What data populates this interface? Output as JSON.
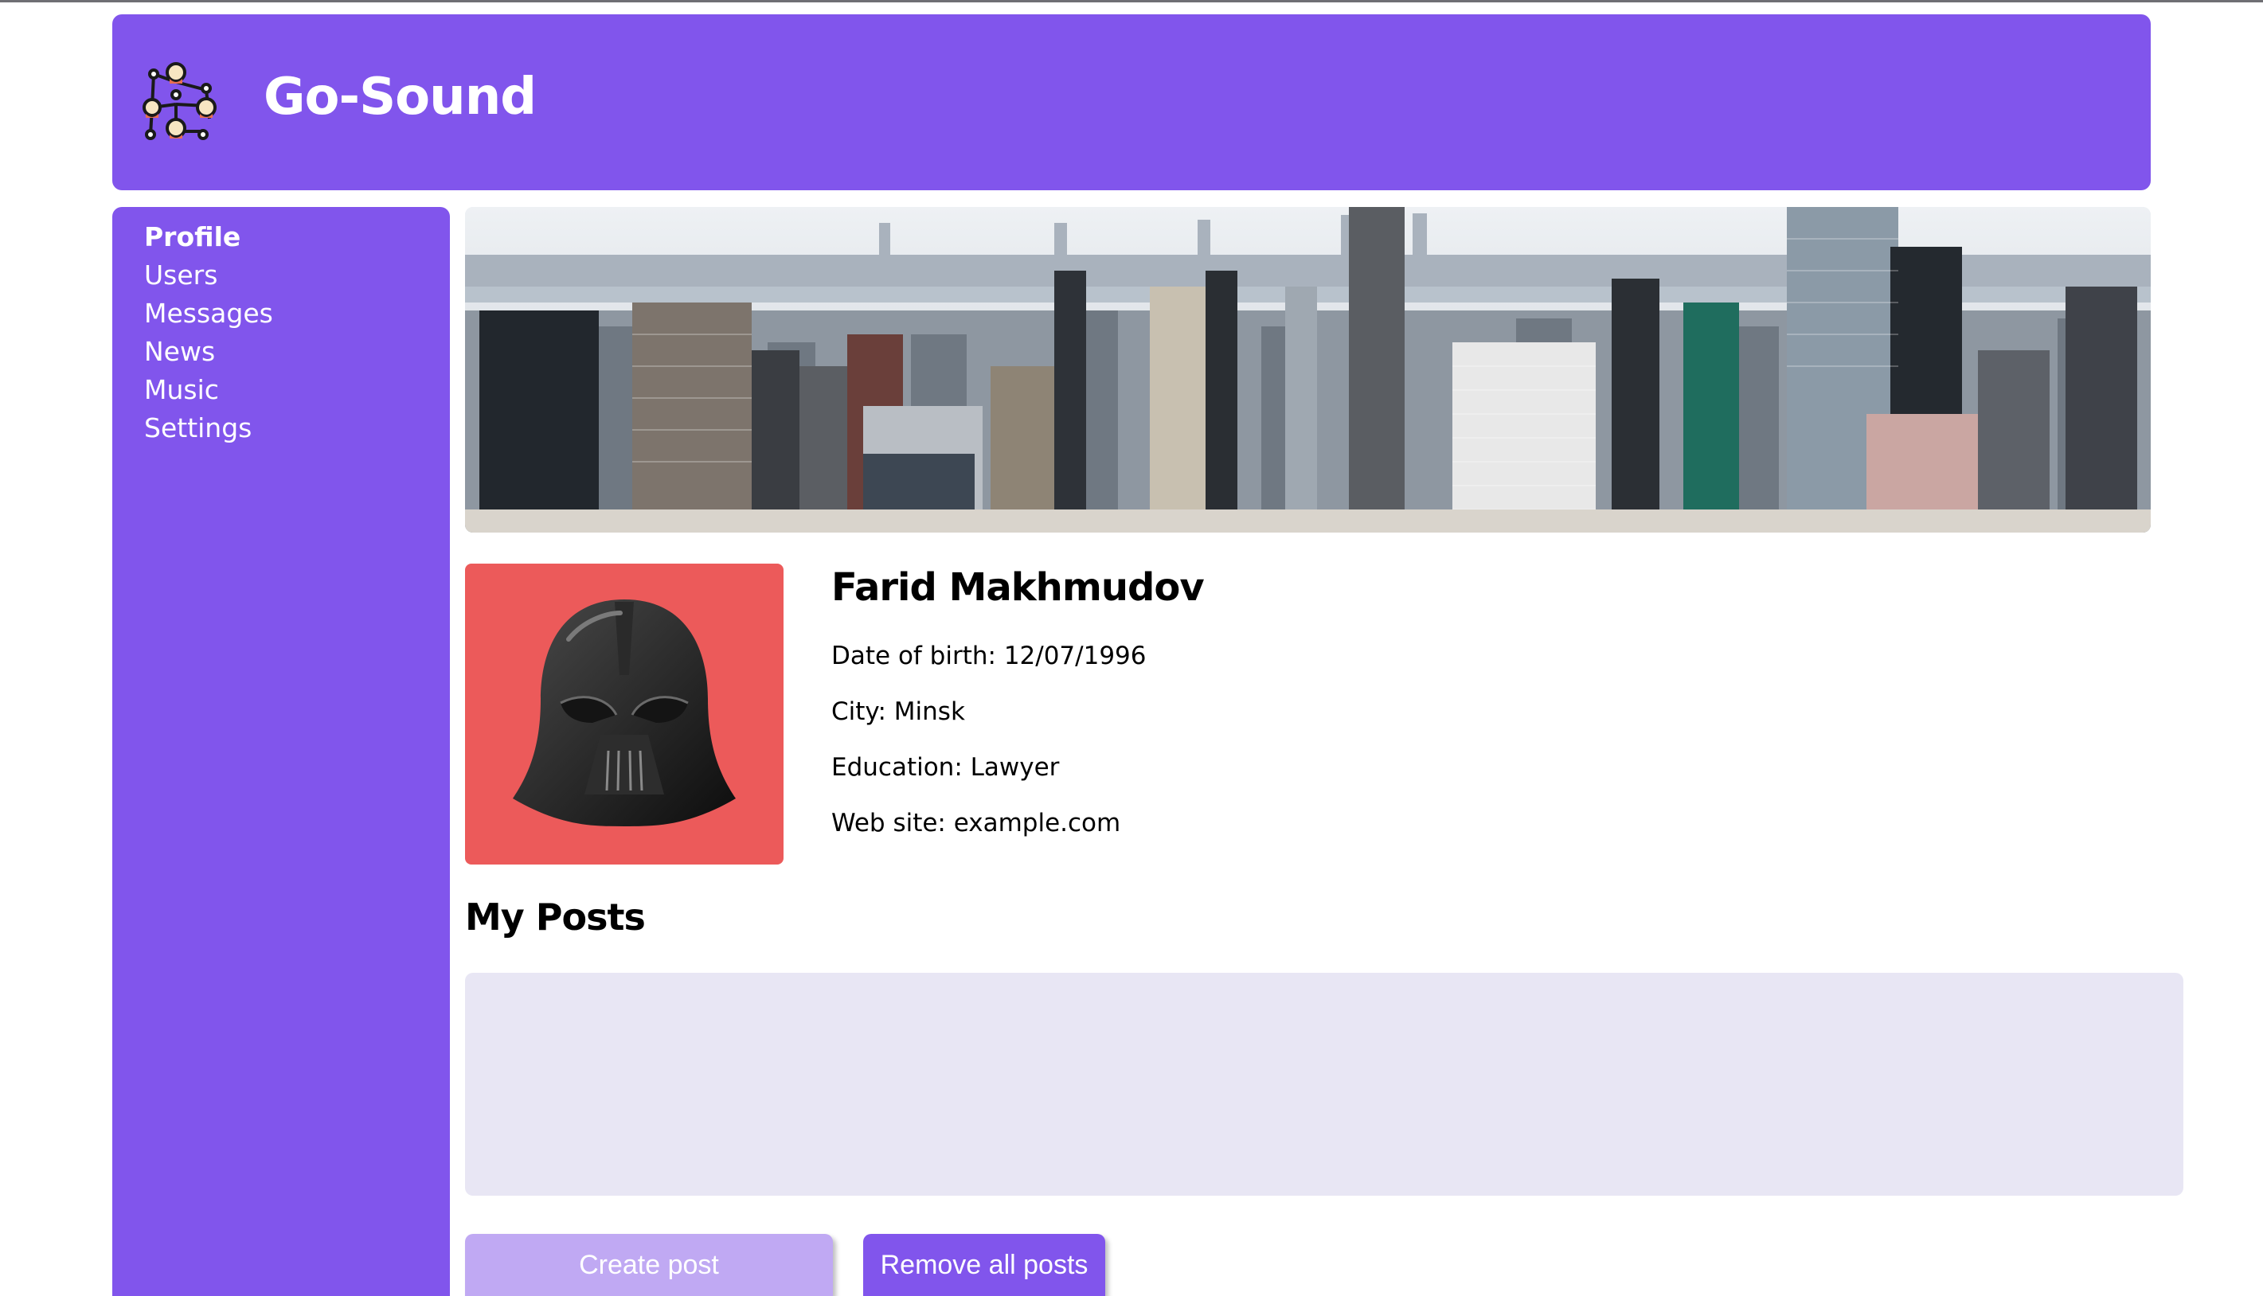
{
  "app": {
    "title": "Go-Sound",
    "logo_icon": "network-of-people-icon"
  },
  "sidebar": {
    "items": [
      {
        "label": "Profile",
        "active": true
      },
      {
        "label": "Users",
        "active": false
      },
      {
        "label": "Messages",
        "active": false
      },
      {
        "label": "News",
        "active": false
      },
      {
        "label": "Music",
        "active": false
      },
      {
        "label": "Settings",
        "active": false
      }
    ]
  },
  "banner": {
    "image": "city-skyline-photo"
  },
  "profile": {
    "avatar": "darth-vader-helmet-icon",
    "name": "Farid Makhmudov",
    "birth": "Date of birth: 12/07/1996",
    "city": "City: Minsk",
    "education": "Education: Lawyer",
    "website": "Web site: example.com"
  },
  "posts": {
    "title": "My Posts",
    "input_value": "",
    "create_label": "Create post",
    "remove_label": "Remove all posts"
  },
  "colors": {
    "brand": "#8155ec",
    "brand_light": "#c0a9f3",
    "avatar_bg": "#ec5a5a",
    "input_bg": "#e8e6f4"
  }
}
